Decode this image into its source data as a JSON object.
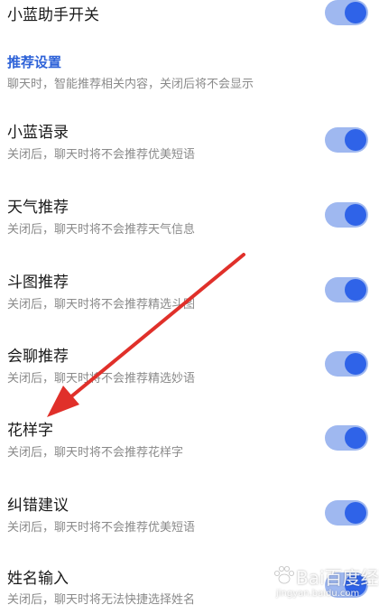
{
  "settings": {
    "master_toggle": {
      "title": "小蓝助手开关",
      "on": true
    },
    "section": {
      "title": "推荐设置",
      "description": "聊天时，智能推荐相关内容，关闭后将不会显示"
    },
    "items": [
      {
        "title": "小蓝语录",
        "description": "关闭后，聊天时将不会推荐优美短语",
        "on": true
      },
      {
        "title": "天气推荐",
        "description": "关闭后，聊天时将不会推荐天气信息",
        "on": true
      },
      {
        "title": "斗图推荐",
        "description": "关闭后，聊天时将不会推荐精选斗图",
        "on": true
      },
      {
        "title": "会聊推荐",
        "description": "关闭后，聊天时将不会推荐精选妙语",
        "on": true
      },
      {
        "title": "花样字",
        "description": "关闭后，聊天时将不会推荐花样字",
        "on": true
      },
      {
        "title": "纠错建议",
        "description": "关闭后，聊天时将不会推荐优美短语",
        "on": true
      },
      {
        "title": "姓名输入",
        "description": "关闭后，聊天时将无法快捷选择姓名",
        "on": true
      }
    ]
  },
  "colors": {
    "accent": "#2f63e8",
    "track": "#9fb8f0",
    "section_title": "#2f63d8",
    "arrow": "#e0302a"
  },
  "watermark": {
    "brand": "Bai百度经验",
    "url": "jingyan.baidu.com"
  }
}
